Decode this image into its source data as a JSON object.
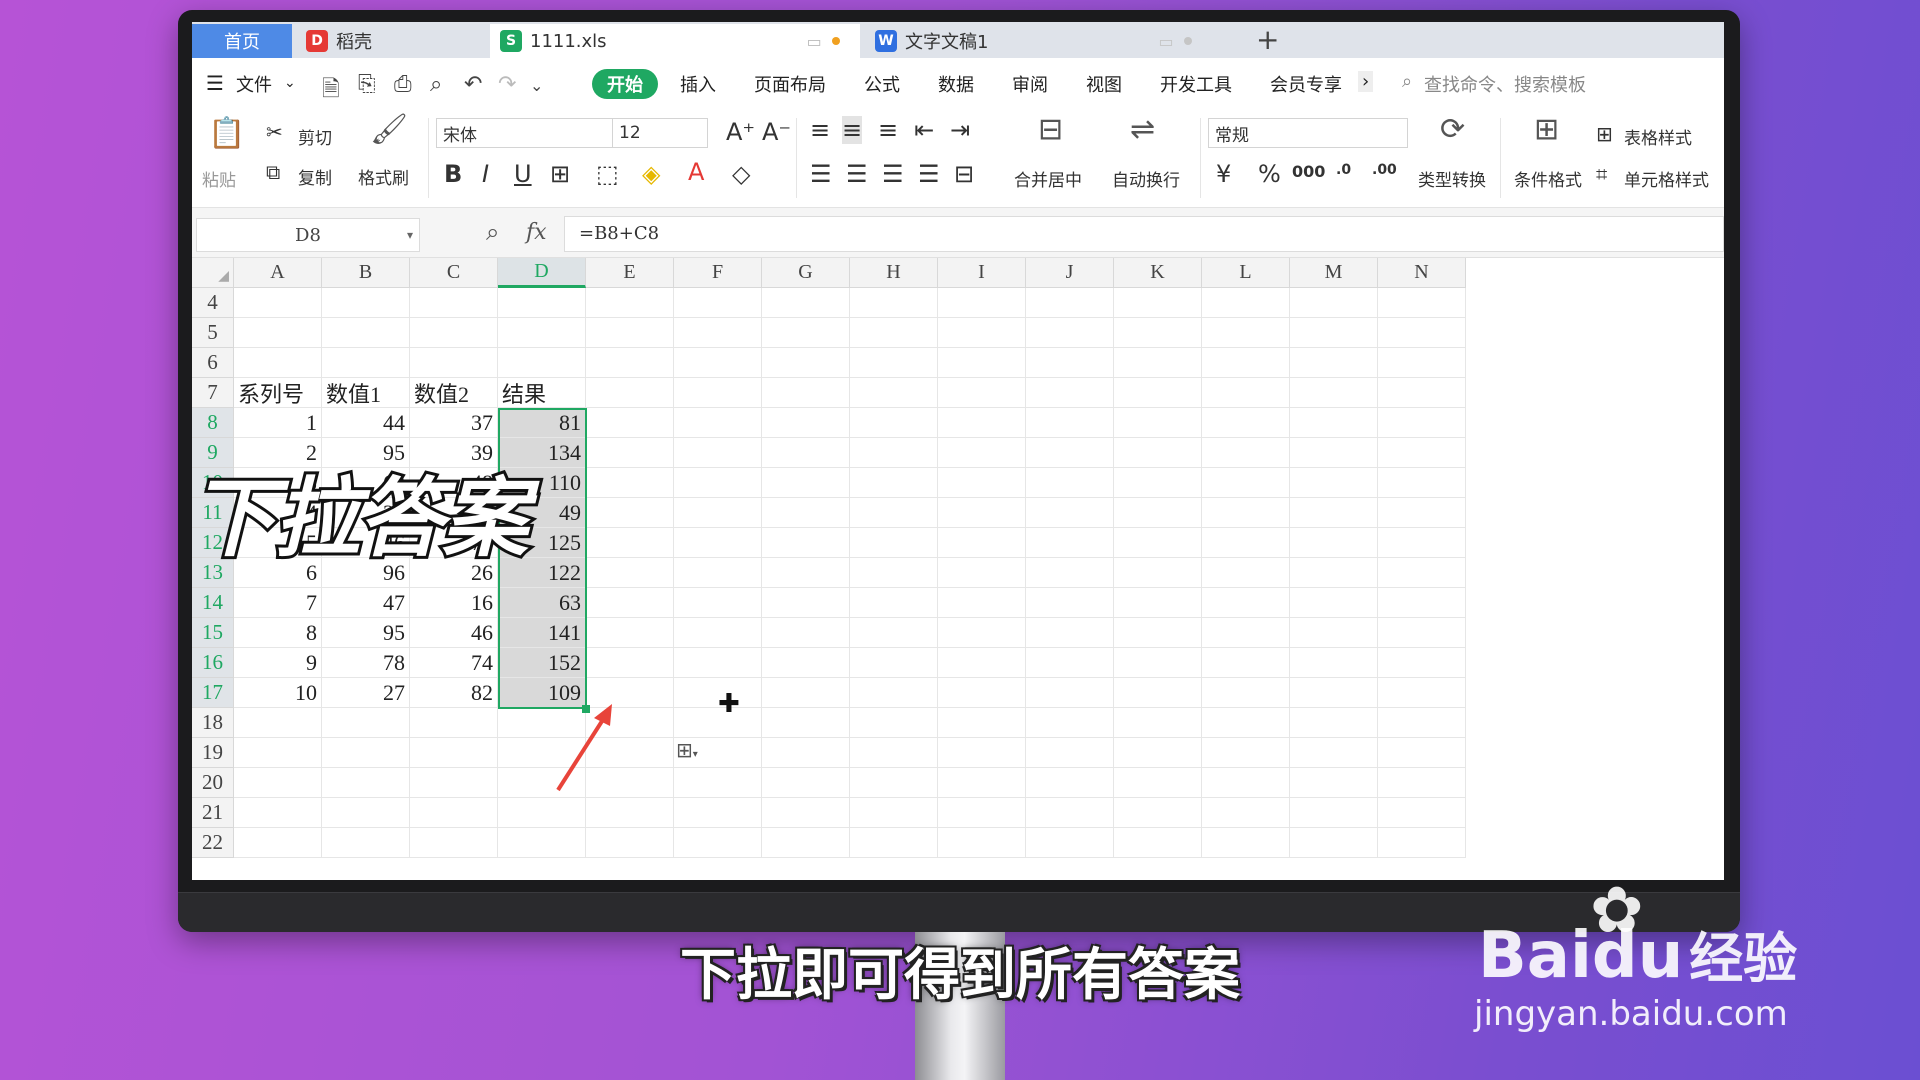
{
  "tabs": {
    "home": "首页",
    "daoke": "稻壳",
    "file": "1111.xls",
    "doc": "文字文稿1",
    "new_tab": "+"
  },
  "menu": {
    "file": "文件",
    "items": [
      "开始",
      "插入",
      "页面布局",
      "公式",
      "数据",
      "审阅",
      "视图",
      "开发工具",
      "会员专享"
    ],
    "search_placeholder": "查找命令、搜索模板"
  },
  "ribbon": {
    "paste": "粘贴",
    "cut": "剪切",
    "copy": "复制",
    "format_painter": "格式刷",
    "font_name": "宋体",
    "font_size": "12",
    "merge_center": "合并居中",
    "wrap_text": "自动换行",
    "number_format": "常规",
    "type_convert": "类型转换",
    "conditional_format": "条件格式",
    "table_style": "表格样式",
    "cell_style": "单元格样式"
  },
  "formula_bar": {
    "name_box": "D8",
    "fx": "fx",
    "formula": "=B8+C8"
  },
  "sheet": {
    "columns": [
      "A",
      "B",
      "C",
      "D",
      "E",
      "F",
      "G",
      "H",
      "I",
      "J",
      "K",
      "L",
      "M",
      "N"
    ],
    "rows": [
      4,
      5,
      6,
      7,
      8,
      9,
      10,
      11,
      12,
      13,
      14,
      15,
      16,
      17,
      18,
      19,
      20,
      21,
      22
    ],
    "headers": [
      "系列号",
      "数值1",
      "数值2",
      "结果"
    ],
    "data": [
      [
        1,
        44,
        37,
        81
      ],
      [
        2,
        95,
        39,
        134
      ],
      [
        3,
        62,
        48,
        110
      ],
      [
        4,
        22,
        27,
        49
      ],
      [
        5,
        46,
        79,
        125
      ],
      [
        6,
        96,
        26,
        122
      ],
      [
        7,
        47,
        16,
        63
      ],
      [
        8,
        95,
        46,
        141
      ],
      [
        9,
        78,
        74,
        152
      ],
      [
        10,
        27,
        82,
        109
      ]
    ]
  },
  "overlay": {
    "title": "下拉答案",
    "subtitle": "下拉即可得到所有答案"
  },
  "watermark": {
    "brand": "Bai",
    "brand2": "du",
    "jingyan": "经验",
    "url": "jingyan.baidu.com"
  },
  "colors": {
    "accent": "#1fa862",
    "tab_home": "#4e8ae6"
  }
}
